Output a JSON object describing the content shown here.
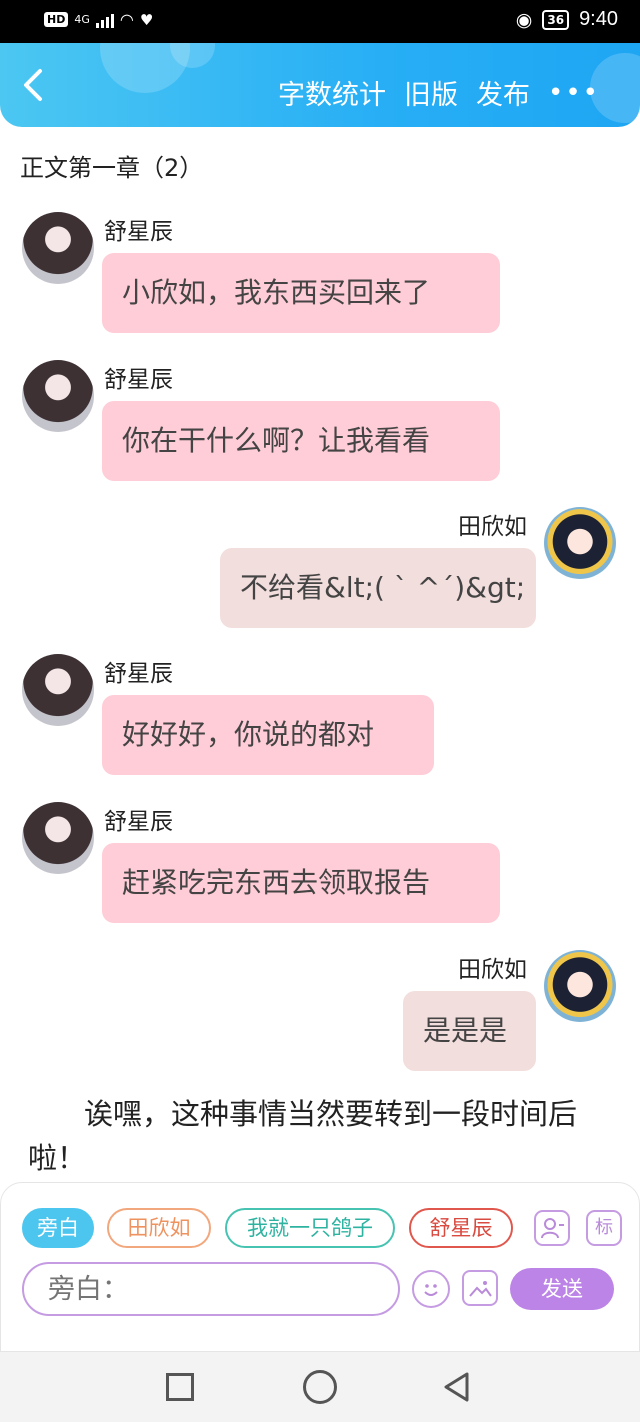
{
  "status_bar": {
    "hd": "HD",
    "network": "4G",
    "battery": "36",
    "time": "9:40"
  },
  "header": {
    "back_icon": "chevron-left-icon",
    "actions": [
      "字数统计",
      "旧版",
      "发布"
    ],
    "more_label": "•••",
    "colors": {
      "gradient_start": "#4cc7f2",
      "gradient_end": "#1ea6f3"
    }
  },
  "chapter_title": "正文第一章（2）",
  "messages": [
    {
      "side": "left",
      "name": "舒星辰",
      "text": "小欣如，我东西买回来了"
    },
    {
      "side": "left",
      "name": "舒星辰",
      "text": "你在干什么啊？让我看看"
    },
    {
      "side": "right",
      "name": "田欣如",
      "text": "不给看&lt;( ` ^´)&gt;"
    },
    {
      "side": "left",
      "name": "舒星辰",
      "text": "好好好，你说的都对"
    },
    {
      "side": "left",
      "name": "舒星辰",
      "text": "赶紧吃完东西去领取报告"
    },
    {
      "side": "right",
      "name": "田欣如",
      "text": "是是是"
    }
  ],
  "narration": "诶嘿，这种事情当然要转到一段时间后啦！",
  "roles": [
    {
      "label": "旁白",
      "style": "active"
    },
    {
      "label": "田欣如",
      "style": "orange"
    },
    {
      "label": "我就一只鸽子",
      "style": "teal"
    },
    {
      "label": "舒星辰",
      "style": "red"
    }
  ],
  "tool_buttons": {
    "person_icon": "person-add-icon",
    "tag_label": "标"
  },
  "composer": {
    "placeholder": "旁白：",
    "emoji_icon": "emoji-icon",
    "image_icon": "image-icon",
    "send_label": "发送"
  },
  "colors": {
    "left_bubble": "#ffcdd7",
    "right_bubble": "#f2dedc",
    "accent_purple": "#bc84e6"
  }
}
